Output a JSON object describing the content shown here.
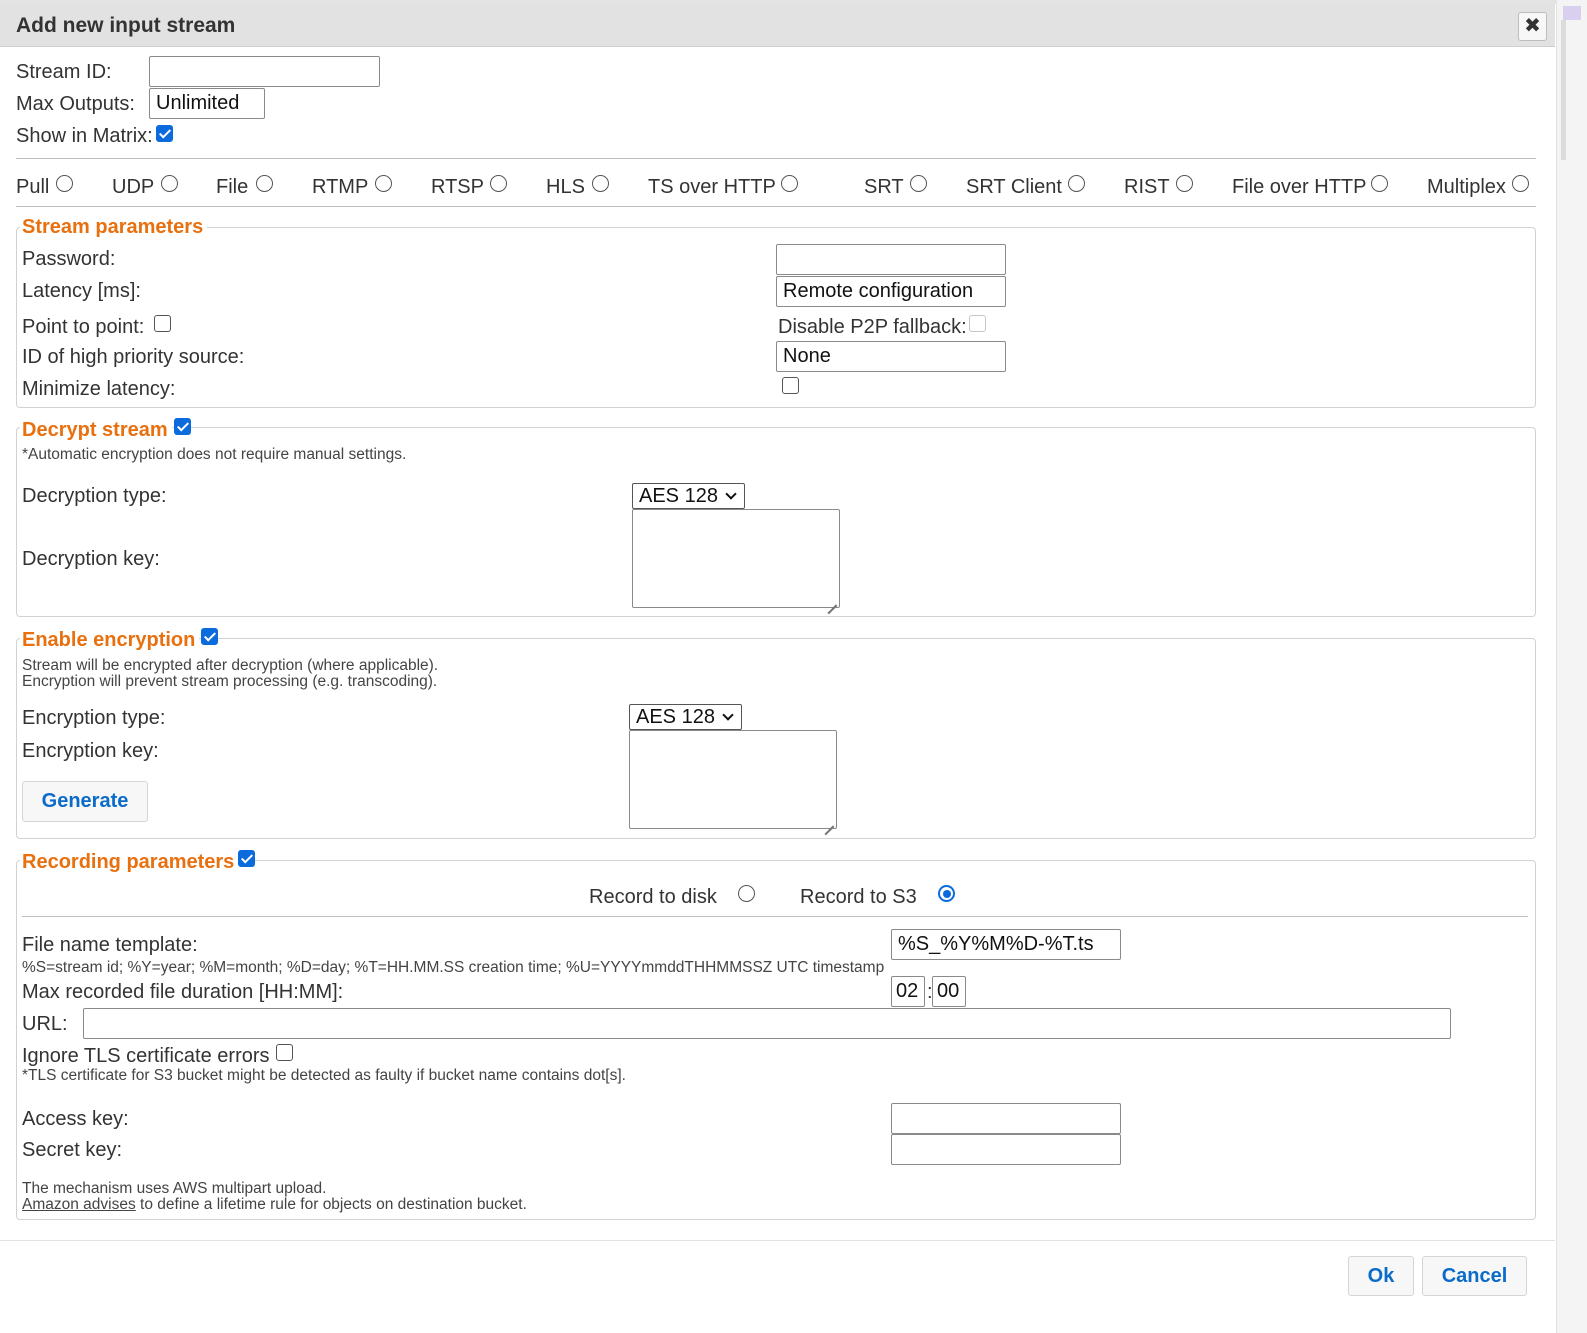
{
  "dialog": {
    "title": "Add new input stream",
    "close_glyph": "✖"
  },
  "general": {
    "stream_id_label": "Stream ID:",
    "stream_id_value": "",
    "max_outputs_label": "Max Outputs:",
    "max_outputs_value": "Unlimited",
    "show_in_matrix_label": "Show in Matrix:",
    "show_in_matrix_checked": true
  },
  "protocols": [
    {
      "label": "Pull",
      "selected": false
    },
    {
      "label": "UDP",
      "selected": false
    },
    {
      "label": "File",
      "selected": false
    },
    {
      "label": "RTMP",
      "selected": false
    },
    {
      "label": "RTSP",
      "selected": false
    },
    {
      "label": "HLS",
      "selected": false
    },
    {
      "label": "TS over HTTP",
      "selected": false
    },
    {
      "label": "SRT",
      "selected": false
    },
    {
      "label": "SRT Client",
      "selected": false
    },
    {
      "label": "RIST",
      "selected": false
    },
    {
      "label": "File over HTTP",
      "selected": false
    },
    {
      "label": "Multiplex",
      "selected": false
    }
  ],
  "stream_params": {
    "legend": "Stream parameters",
    "password_label": "Password:",
    "password_value": "",
    "latency_label": "Latency [ms]:",
    "latency_value": "Remote configuration",
    "p2p_label": "Point to point:",
    "p2p_checked": false,
    "disable_fallback_label": "Disable P2P fallback:",
    "disable_fallback_checked": false,
    "high_priority_label": "ID of high priority source:",
    "high_priority_value": "None",
    "minimize_latency_label": "Minimize latency:",
    "minimize_latency_checked": false
  },
  "decrypt": {
    "legend": "Decrypt stream",
    "checked": true,
    "note": "*Automatic encryption does not require manual settings.",
    "type_label": "Decryption type:",
    "type_value": "AES 128",
    "key_label": "Decryption key:",
    "key_value": ""
  },
  "encrypt": {
    "legend": "Enable encryption",
    "checked": true,
    "note1": "Stream will be encrypted after decryption (where applicable).",
    "note2": "Encryption will prevent stream processing (e.g. transcoding).",
    "type_label": "Encryption type:",
    "type_value": "AES 128",
    "key_label": "Encryption key:",
    "key_value": "",
    "generate_label": "Generate"
  },
  "recording": {
    "legend": "Recording parameters",
    "checked": true,
    "disk_label": "Record to disk",
    "disk_selected": false,
    "s3_label": "Record to S3",
    "s3_selected": true,
    "template_label": "File name template:",
    "template_value": "%S_%Y%M%D-%T.ts",
    "template_hint": "%S=stream id; %Y=year; %M=month; %D=day; %T=HH.MM.SS creation time; %U=YYYYmmddTHHMMSSZ UTC timestamp",
    "duration_label": "Max recorded file duration [HH:MM]:",
    "duration_hours": "02",
    "duration_sep": ":",
    "duration_minutes": "00",
    "url_label": "URL:",
    "url_value": "",
    "tls_label": "Ignore TLS certificate errors",
    "tls_checked": false,
    "tls_note": "*TLS certificate for S3 bucket might be detected as faulty if bucket name contains dot[s].",
    "access_key_label": "Access key:",
    "access_key_value": "",
    "secret_key_label": "Secret key:",
    "secret_key_value": "",
    "footer_note1": "The mechanism uses AWS multipart upload.",
    "footer_link": "Amazon advises",
    "footer_note2": " to define a lifetime rule for objects on destination bucket."
  },
  "footer": {
    "ok_label": "Ok",
    "cancel_label": "Cancel"
  },
  "colors": {
    "accent": "#0b6bdc",
    "legend": "#e8700f",
    "button_text": "#0b6bc9"
  }
}
